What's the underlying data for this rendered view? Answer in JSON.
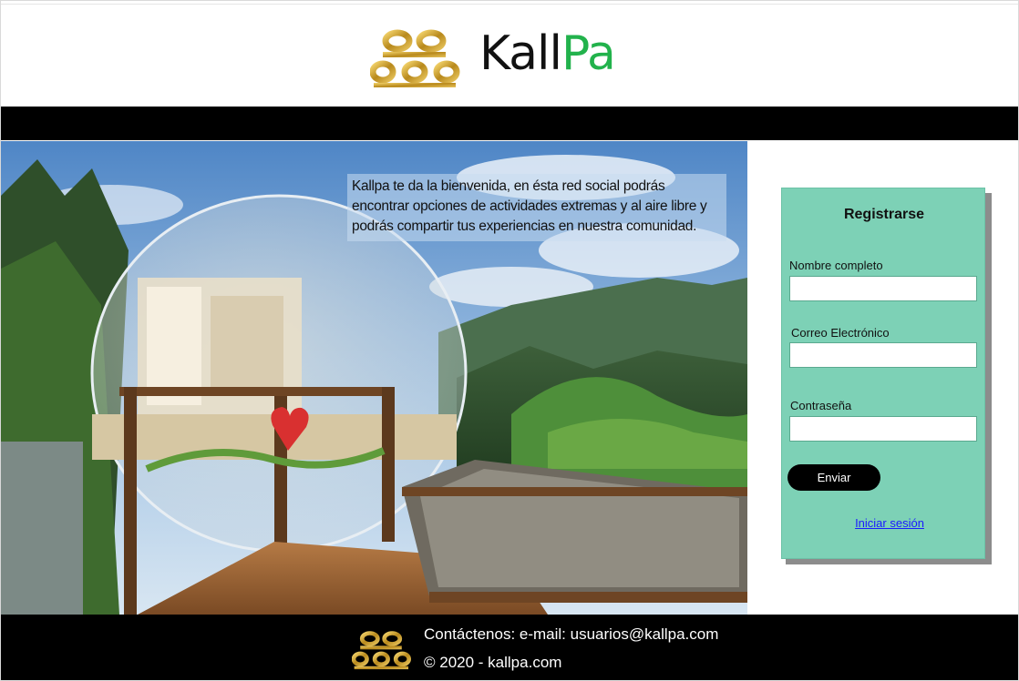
{
  "header": {
    "brand_part1": "Kall",
    "brand_part2": "Pa",
    "logo_icon": "kallpa-logo-icon",
    "brand_colors": {
      "gold": "#c9a227",
      "green": "#22b24c",
      "black": "#111111"
    }
  },
  "hero": {
    "welcome_text": "Kallpa te da la bienvenida, en ésta red social podrás encontrar opciones de actividades extremas y al aire libre y podrás compartir tus experiencias en nuestra comunidad."
  },
  "register": {
    "title": "Registrarse",
    "name_label": "Nombre completo",
    "name_value": "",
    "email_label": "Correo Electrónico",
    "email_value": "",
    "password_label": "Contraseña",
    "password_value": "",
    "submit_label": "Enviar",
    "login_link": "Iniciar sesión",
    "card_color": "#7dd1b6"
  },
  "footer": {
    "contact": "Contáctenos: e-mail: usuarios@kallpa.com",
    "copyright": "© 2020 - kallpa.com"
  }
}
